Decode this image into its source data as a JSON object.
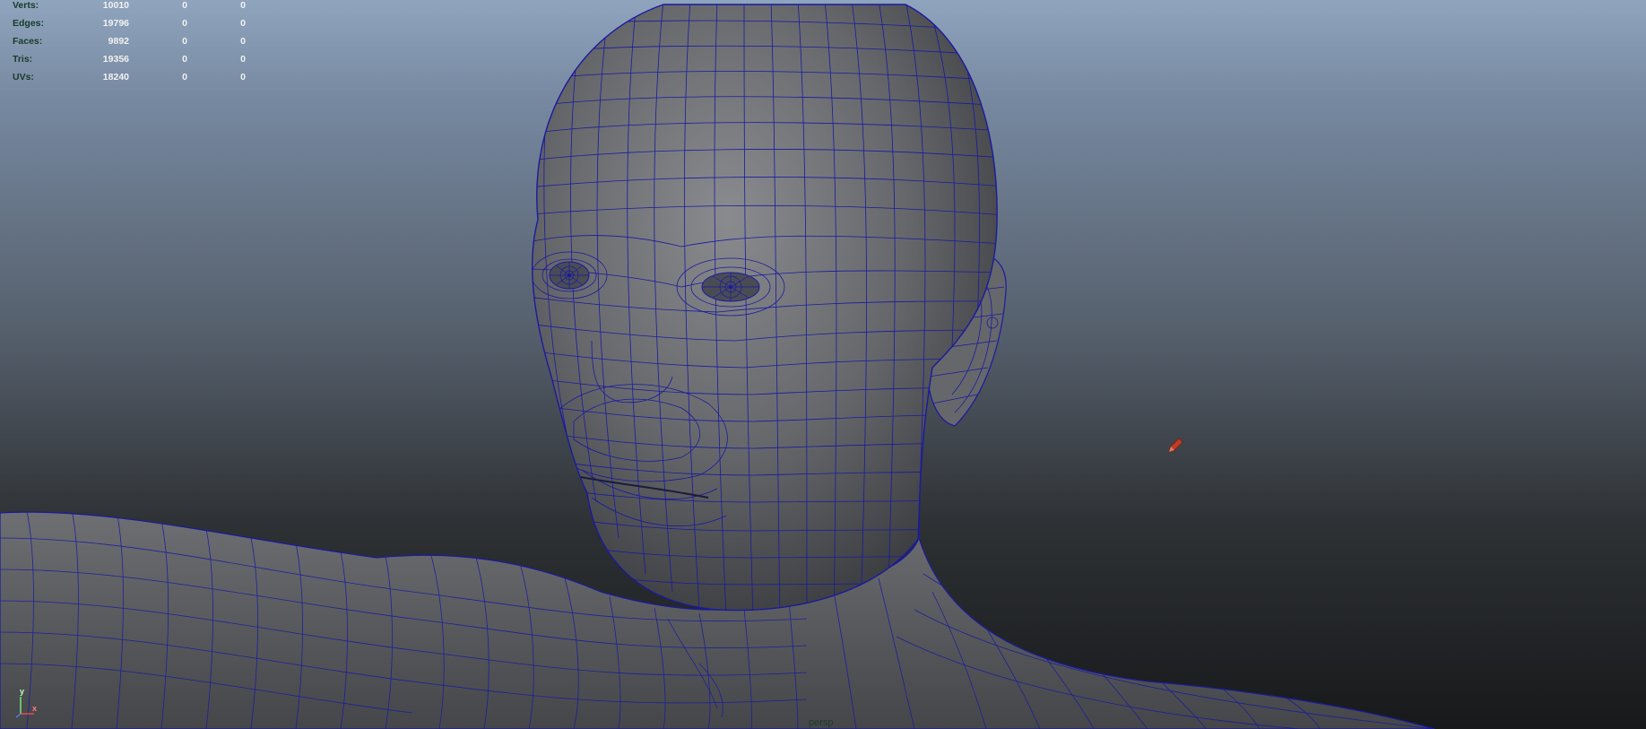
{
  "hud": {
    "rows": [
      {
        "label": "Verts:",
        "total": "10010",
        "selected": "0",
        "component": "0"
      },
      {
        "label": "Edges:",
        "total": "19796",
        "selected": "0",
        "component": "0"
      },
      {
        "label": "Faces:",
        "total": "9892",
        "selected": "0",
        "component": "0"
      },
      {
        "label": "Tris:",
        "total": "19356",
        "selected": "0",
        "component": "0"
      },
      {
        "label": "UVs:",
        "total": "18240",
        "selected": "0",
        "component": "0"
      }
    ]
  },
  "axis": {
    "y": "y",
    "x": "x"
  },
  "camera": {
    "name": "persp"
  },
  "colors": {
    "wireframe": "#1a1a9e",
    "mesh_fill": "#5a5b5e",
    "hud_label": "#173b28",
    "hud_value": "#f2f2f2",
    "tool_cursor": "#c23b22"
  },
  "icons": {
    "tool_cursor": "pencil-icon",
    "axis": "axis-gizmo-icon"
  }
}
